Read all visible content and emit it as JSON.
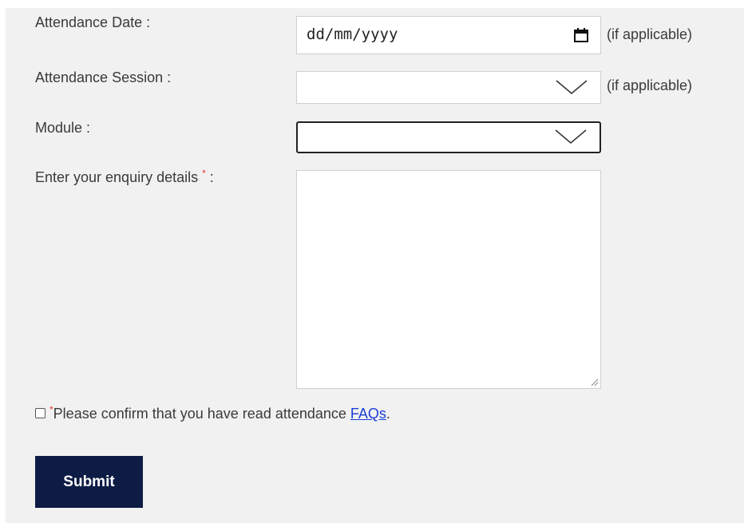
{
  "form": {
    "attendance_date": {
      "label": "Attendance Date :",
      "value": "dd/mm/yyyy",
      "hint": "(if applicable)"
    },
    "attendance_session": {
      "label": "Attendance Session :",
      "value": "",
      "hint": "(if applicable)"
    },
    "module": {
      "label": "Module :",
      "value": ""
    },
    "enquiry": {
      "label": "Enter your enquiry details",
      "required_mark": "*",
      "label_suffix": " :",
      "value": ""
    },
    "confirm": {
      "required_mark": "*",
      "text": "Please confirm that you have read attendance ",
      "link_text": "FAQs",
      "suffix": ".",
      "checked": false
    },
    "submit_label": "Submit"
  },
  "colors": {
    "panel_bg": "#f1f1f1",
    "button_bg": "#0d1c45",
    "required": "#e53935",
    "link": "#1a3fd6"
  },
  "icons": {
    "date": "calendar-icon",
    "dropdown": "chevron-down-icon",
    "resize": "resize-handle-icon"
  }
}
